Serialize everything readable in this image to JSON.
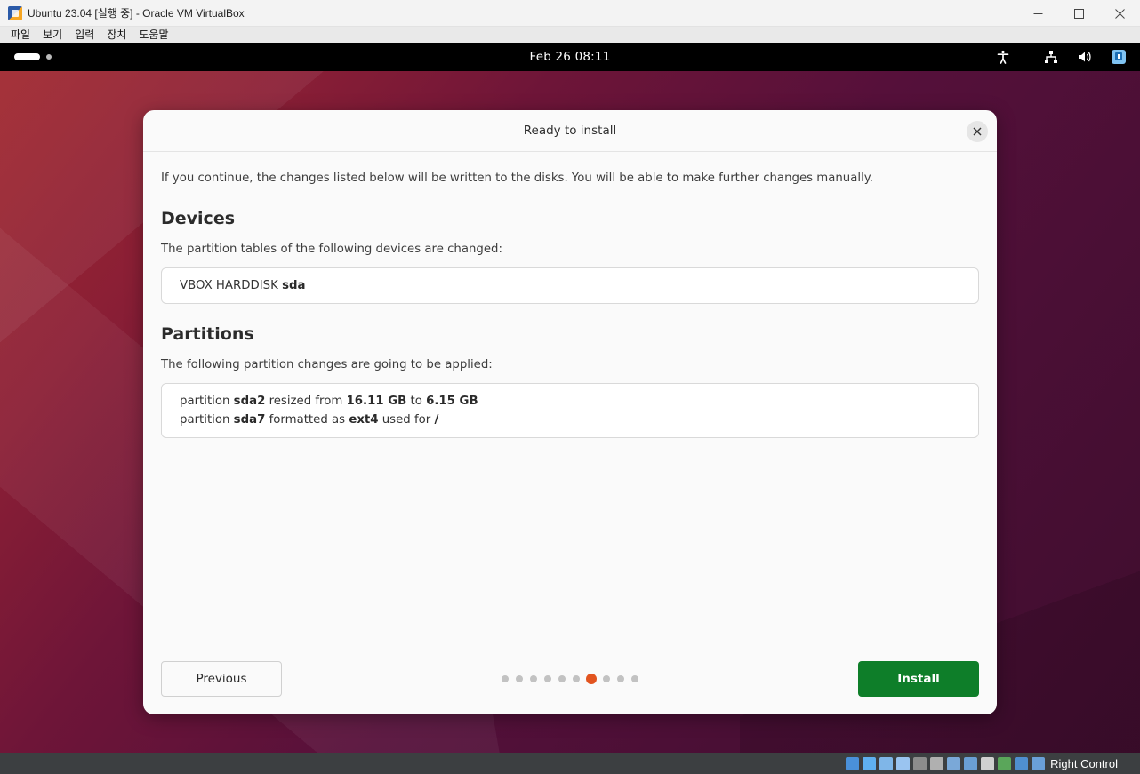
{
  "host": {
    "title": "Ubuntu 23.04 [실행 중] - Oracle VM VirtualBox",
    "menu": [
      "파일",
      "보기",
      "입력",
      "장치",
      "도움말"
    ],
    "status_bar": {
      "icons": [
        {
          "name": "hard-disk-icon",
          "color": "#4a90d9"
        },
        {
          "name": "optical-drive-icon",
          "color": "#5fb0f0"
        },
        {
          "name": "audio-icon",
          "color": "#7fb6e8"
        },
        {
          "name": "network-icon",
          "color": "#9ac4f0"
        },
        {
          "name": "usb-icon",
          "color": "#8c8c8c"
        },
        {
          "name": "shared-folder-icon",
          "color": "#b0b0b0"
        },
        {
          "name": "display-icon",
          "color": "#7aa8d8"
        },
        {
          "name": "video-capture-icon",
          "color": "#6a9fd4"
        },
        {
          "name": "vt-x-icon",
          "color": "#d0d0d0"
        },
        {
          "name": "mouse-integration-icon",
          "color": "#5aa65a"
        },
        {
          "name": "keyboard-capture-icon",
          "color": "#4f8fd0"
        },
        {
          "name": "arrow-icon",
          "color": "#6aa0d8"
        }
      ],
      "host_key": "Right Control"
    }
  },
  "guest": {
    "topbar": {
      "clock": "Feb 26  08:11",
      "tray_icons": [
        "accessibility-icon",
        "network-wired-icon",
        "volume-icon",
        "power-icon"
      ]
    }
  },
  "dialog": {
    "title": "Ready to install",
    "intro": "If you continue, the changes listed below will be written to the disks. You will be able to make further changes manually.",
    "devices": {
      "heading": "Devices",
      "description": "The partition tables of the following devices are changed:",
      "entry_prefix": "VBOX HARDDISK ",
      "entry_device": "sda"
    },
    "partitions": {
      "heading": "Partitions",
      "description": "The following partition changes are going to be applied:",
      "lines": [
        [
          {
            "t": "partition "
          },
          {
            "t": "sda2",
            "b": true
          },
          {
            "t": " resized from "
          },
          {
            "t": "16.11 GB",
            "b": true
          },
          {
            "t": " to "
          },
          {
            "t": "6.15 GB",
            "b": true
          }
        ],
        [
          {
            "t": "partition "
          },
          {
            "t": "sda7",
            "b": true
          },
          {
            "t": " formatted as "
          },
          {
            "t": "ext4",
            "b": true
          },
          {
            "t": " used for "
          },
          {
            "t": "/",
            "b": true
          }
        ]
      ]
    },
    "footer": {
      "previous_label": "Previous",
      "install_label": "Install",
      "page_count": 10,
      "current_page": 7
    }
  },
  "colors": {
    "install_green": "#0e7e29",
    "active_dot": "#e2541f",
    "inactive_dot": "#c2c2c2"
  }
}
